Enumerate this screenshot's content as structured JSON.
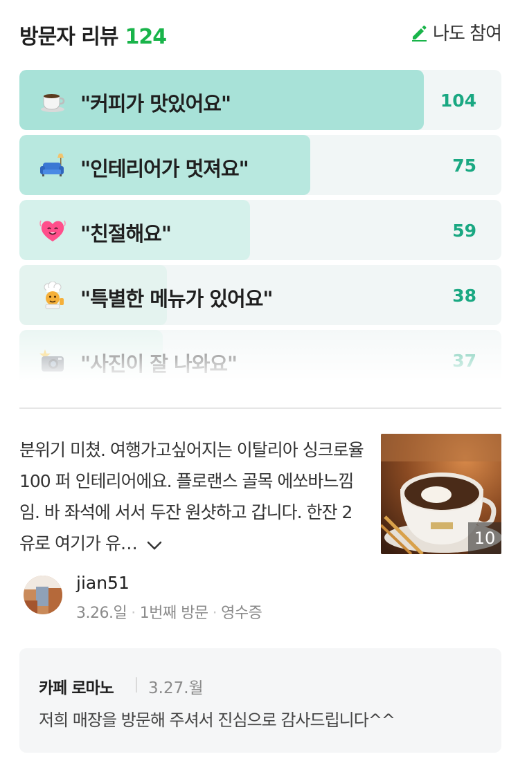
{
  "header": {
    "title": "방문자 리뷰",
    "count": "124",
    "participate_label": "나도 참여"
  },
  "stats": [
    {
      "icon": "coffee-cup-icon",
      "label": "\"커피가 맛있어요\"",
      "count": "104",
      "fraction": 1.0,
      "color": "#a8e2d8"
    },
    {
      "icon": "couch-icon",
      "label": "\"인테리어가 멋져요\"",
      "count": "75",
      "fraction": 0.72,
      "color": "#b8e8df"
    },
    {
      "icon": "heart-face-icon",
      "label": "\"친절해요\"",
      "count": "59",
      "fraction": 0.57,
      "color": "#d5f1eb"
    },
    {
      "icon": "chef-icon",
      "label": "\"특별한 메뉴가 있어요\"",
      "count": "38",
      "fraction": 0.365,
      "color": "#e4f3ef"
    },
    {
      "icon": "camera-flash-icon",
      "label": "\"사진이 잘 나와요\"",
      "count": "37",
      "fraction": 0.355,
      "color": "#e4f3ef"
    }
  ],
  "review": {
    "text": "분위기 미쳤. 여행가고싶어지는 이탈리아 싱크로율 100 퍼 인테리어에요. 플로랜스 골목 에쏘바느낌임. 바 좌석에 서서 두잔 원샷하고 갑니다. 한잔 2유로 여기가 유…",
    "photo_count": "10",
    "author": "jian51",
    "date": "3.26.일",
    "visit": "1번째 방문",
    "verify": "영수증"
  },
  "reply": {
    "owner": "카페 로마노",
    "date": "3.27.월",
    "text": "저희 매장을 방문해 주셔서 진심으로 감사드립니다^^"
  }
}
